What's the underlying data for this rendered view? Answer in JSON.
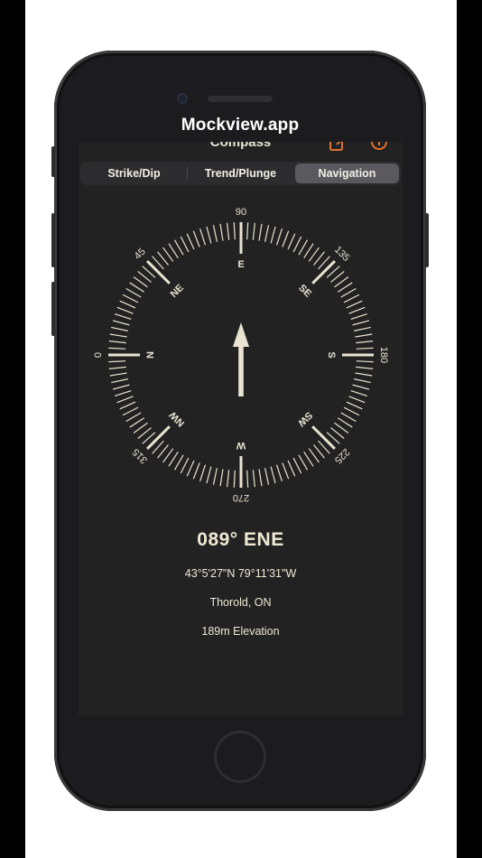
{
  "app": {
    "brand": "Mockview.app",
    "title": "Compass"
  },
  "nav": {
    "left_icon": "share-icon",
    "right_icon": "info-icon",
    "accent": "#e0712c"
  },
  "tabs": [
    {
      "label": "Strike/Dip",
      "selected": false
    },
    {
      "label": "Trend/Plunge",
      "selected": false
    },
    {
      "label": "Navigation",
      "selected": true
    }
  ],
  "compass": {
    "degree_labels": [
      "90",
      "135",
      "180",
      "225",
      "270",
      "315",
      "0",
      "45"
    ],
    "cardinal_labels": [
      "E",
      "SE",
      "S",
      "SW",
      "W",
      "NW",
      "N",
      "NE"
    ],
    "heading_deg": 89,
    "needle_icon": "arrow-up-icon",
    "dial_color": "#e9e4d2",
    "background": "#222222"
  },
  "info": {
    "heading": "089° ENE",
    "coordinates": "43°5'27\"N  79°11'31\"W",
    "location": "Thorold, ON",
    "elevation": "189m  Elevation"
  }
}
